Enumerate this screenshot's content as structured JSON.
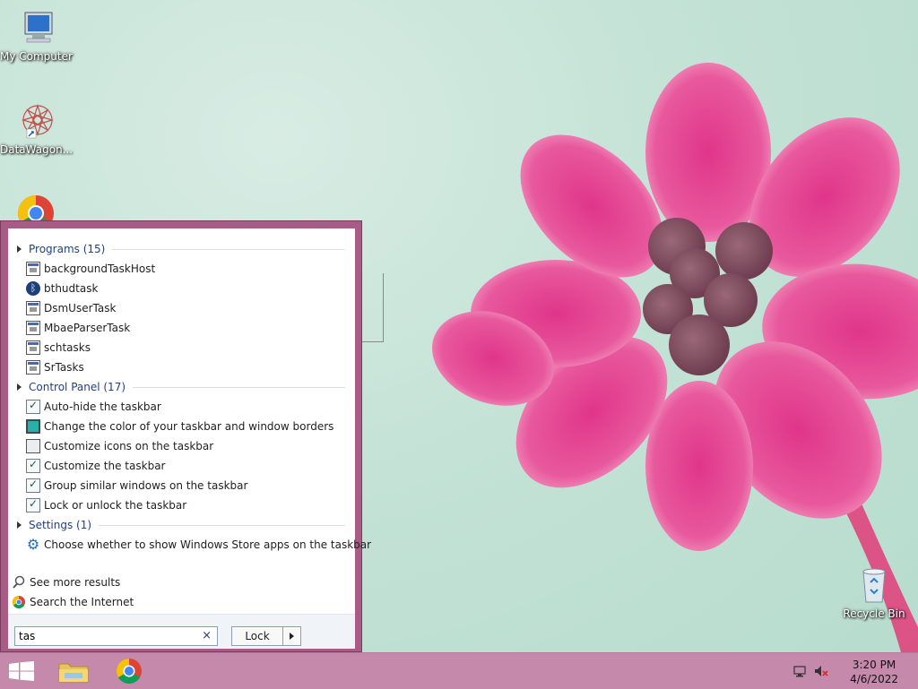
{
  "desktop": {
    "icons": [
      {
        "name": "My Computer"
      },
      {
        "name": "DataWagon..."
      },
      {
        "name": "Recycle Bin"
      }
    ]
  },
  "search_menu": {
    "categories": {
      "programs": {
        "label": "Programs (15)"
      },
      "control_panel": {
        "label": "Control Panel (17)"
      },
      "settings": {
        "label": "Settings (1)"
      }
    },
    "programs": [
      "backgroundTaskHost",
      "bthudtask",
      "DsmUserTask",
      "MbaeParserTask",
      "schtasks",
      "SrTasks"
    ],
    "control_panel": [
      "Auto-hide the taskbar",
      "Change the color of your taskbar and window borders",
      "Customize icons on the taskbar",
      "Customize the taskbar",
      "Group similar windows on the taskbar",
      "Lock or unlock the taskbar"
    ],
    "settings": [
      "Choose whether to show Windows Store apps on the taskbar"
    ],
    "see_more": "See more results",
    "search_internet": "Search the Internet",
    "search_value": "tas",
    "clear_icon": "×",
    "power_button": "Lock"
  },
  "taskbar": {
    "time": "3:20 PM",
    "date": "4/6/2022"
  },
  "colors": {
    "menu_border": "#a85b85",
    "taskbar": "#c58aab",
    "link_blue": "#1f3f8a"
  }
}
